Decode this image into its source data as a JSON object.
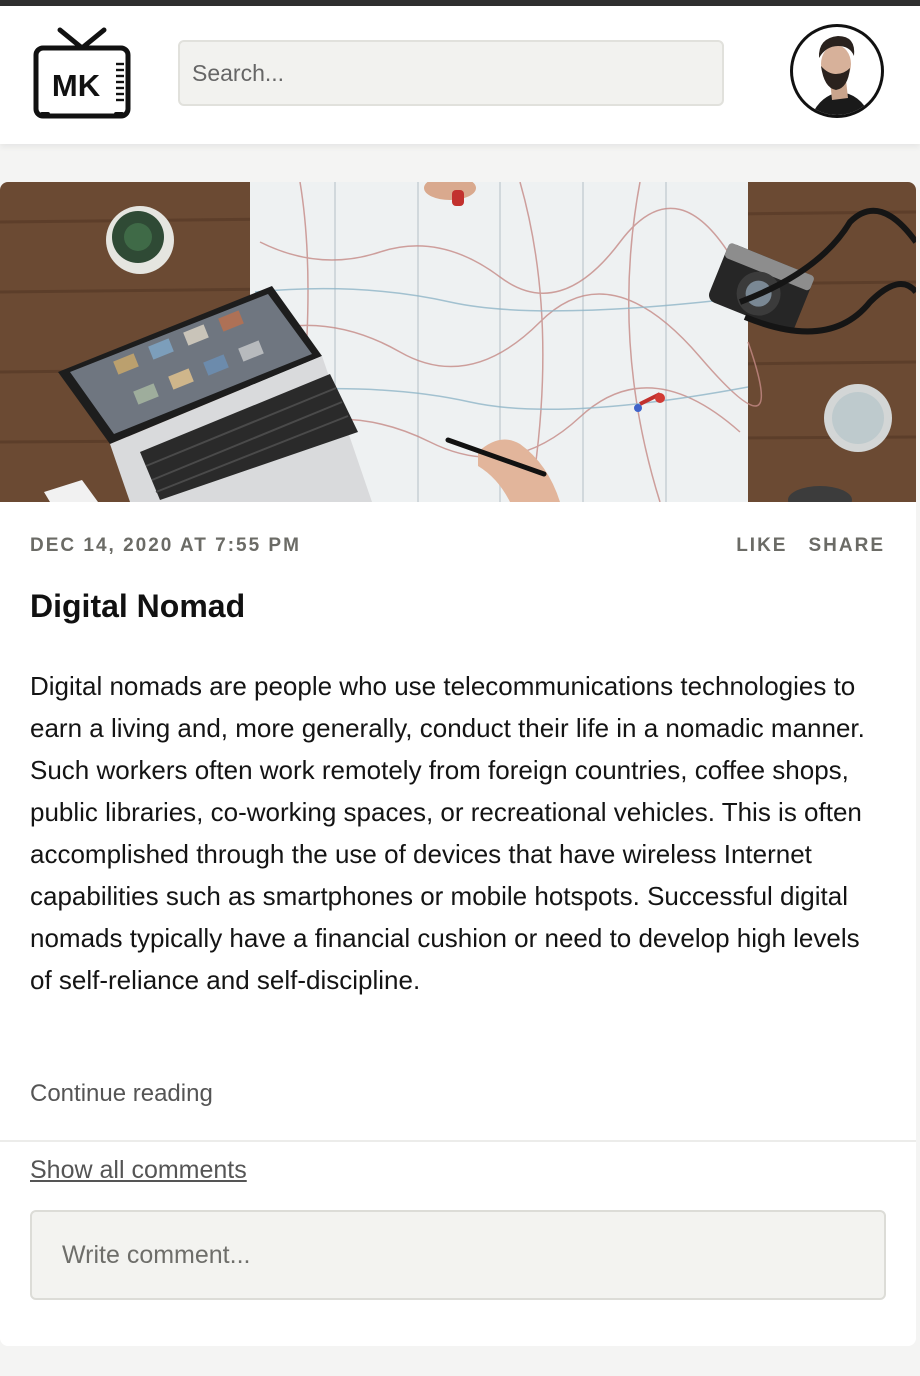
{
  "header": {
    "logo_text": "MK",
    "search_placeholder": "Search..."
  },
  "post": {
    "date": "DEC 14, 2020 AT 7:55 PM",
    "like_label": "LIKE",
    "share_label": "SHARE",
    "title": "Digital Nomad",
    "body": "Digital nomads are people who use telecommunications technologies to earn a living and, more generally, conduct their life in a nomadic manner. Such workers often work remotely from foreign countries, coffee shops, public libraries, co-working spaces, or recreational vehicles. This is often accomplished through the use of devices that have wireless Internet capabilities such as smartphones or mobile hotspots. Successful digital nomads typically have a financial cushion or need to develop high levels of self-reliance and self-discipline.",
    "continue_label": "Continue reading",
    "show_comments_label": "Show all comments",
    "comment_placeholder": "Write comment..."
  }
}
